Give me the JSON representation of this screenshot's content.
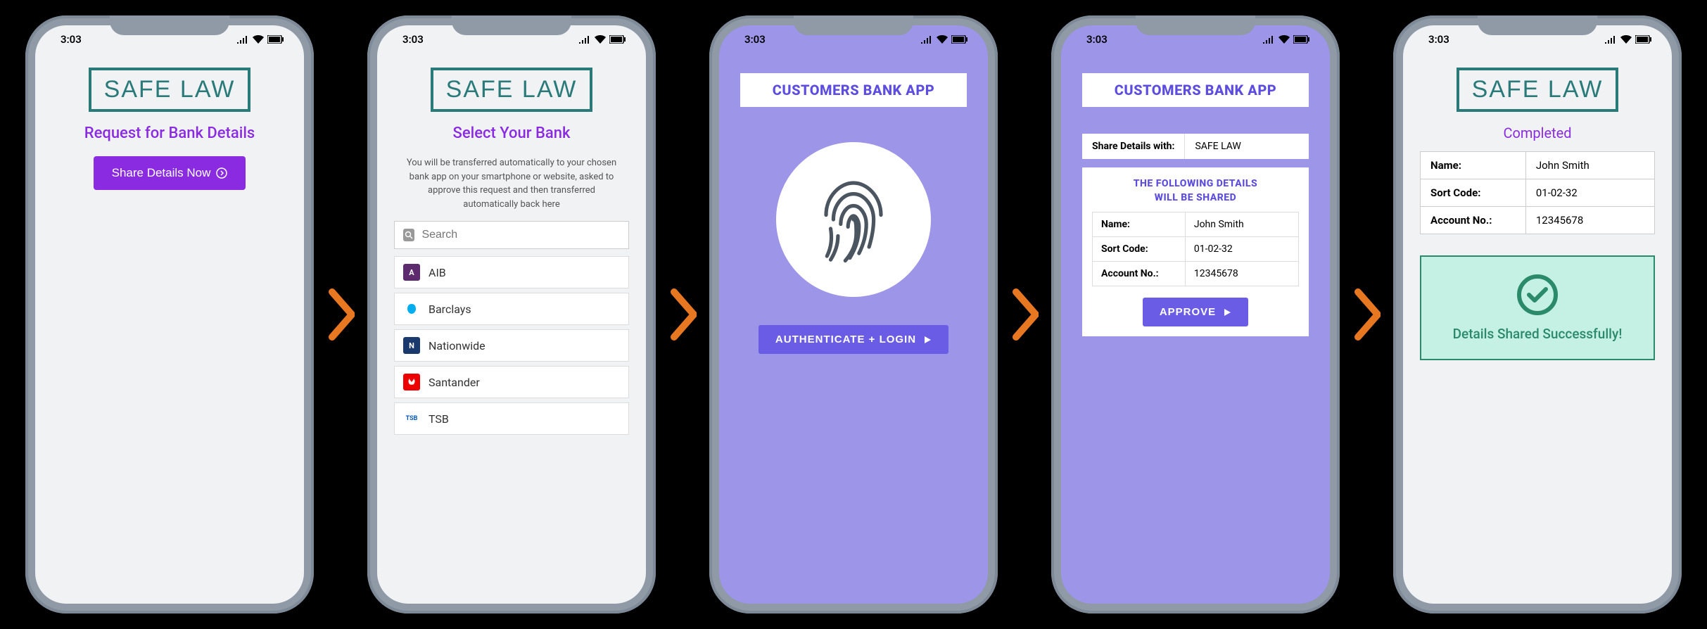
{
  "status_time": "3:03",
  "brand_name": "SAFE LAW",
  "colors": {
    "purple_accent": "#8a2be2",
    "periwinkle_bg": "#9d95e8",
    "periwinkle_btn": "#6b5ce5",
    "teal": "#2a7a7a",
    "success_green": "#2a8a6a",
    "arrow_orange": "#e87722"
  },
  "screen1": {
    "heading": "Request for Bank Details",
    "button_label": "Share Details Now"
  },
  "screen2": {
    "heading": "Select Your Bank",
    "description": "You will be transferred automatically to your chosen bank app on your smartphone or website, asked to approve this request and then transferred automatically back here",
    "search_placeholder": "Search",
    "banks": [
      {
        "name": "AIB",
        "color": "#5e2a6e"
      },
      {
        "name": "Barclays",
        "color": "#00aeef"
      },
      {
        "name": "Nationwide",
        "color": "#1a3a6e"
      },
      {
        "name": "Santander",
        "color": "#ec0000"
      },
      {
        "name": "TSB",
        "color": "#ffffff"
      }
    ]
  },
  "screen3": {
    "header": "CUSTOMERS BANK APP",
    "button_label": "AUTHENTICATE + LOGIN"
  },
  "screen4": {
    "header": "CUSTOMERS BANK APP",
    "share_label": "Share Details with:",
    "share_value": "SAFE LAW",
    "details_title_line1": "THE FOLLOWING DETAILS",
    "details_title_line2": "WILL BE SHARED",
    "rows": [
      {
        "label": "Name:",
        "value": "John Smith"
      },
      {
        "label": "Sort Code:",
        "value": "01-02-32"
      },
      {
        "label": "Account No.:",
        "value": "12345678"
      }
    ],
    "button_label": "APPROVE"
  },
  "screen5": {
    "heading": "Completed",
    "rows": [
      {
        "label": "Name:",
        "value": "John Smith"
      },
      {
        "label": "Sort Code:",
        "value": "01-02-32"
      },
      {
        "label": "Account No.:",
        "value": "12345678"
      }
    ],
    "success_message": "Details Shared Successfully!"
  }
}
